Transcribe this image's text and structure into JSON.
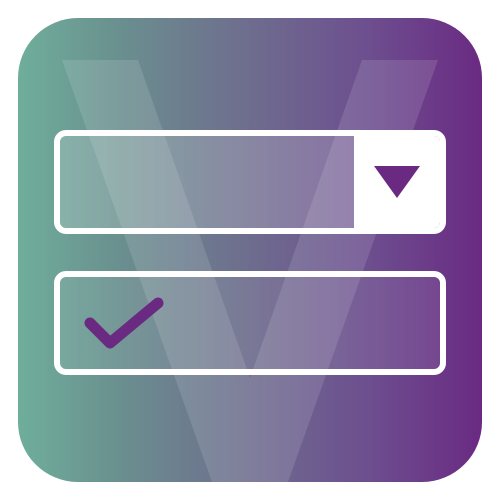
{
  "icon": {
    "name": "dropdown-validation-app-icon",
    "watermark_letter": "V",
    "colors": {
      "gradient_start": "#6fae9b",
      "gradient_end": "#6a2a82",
      "foreground": "#ffffff",
      "accent": "#6a2a82"
    },
    "dropdown": {
      "selected_value": "",
      "arrow_icon": "triangle-down-icon"
    },
    "checkbox": {
      "checked": true,
      "check_icon": "checkmark-icon"
    }
  }
}
